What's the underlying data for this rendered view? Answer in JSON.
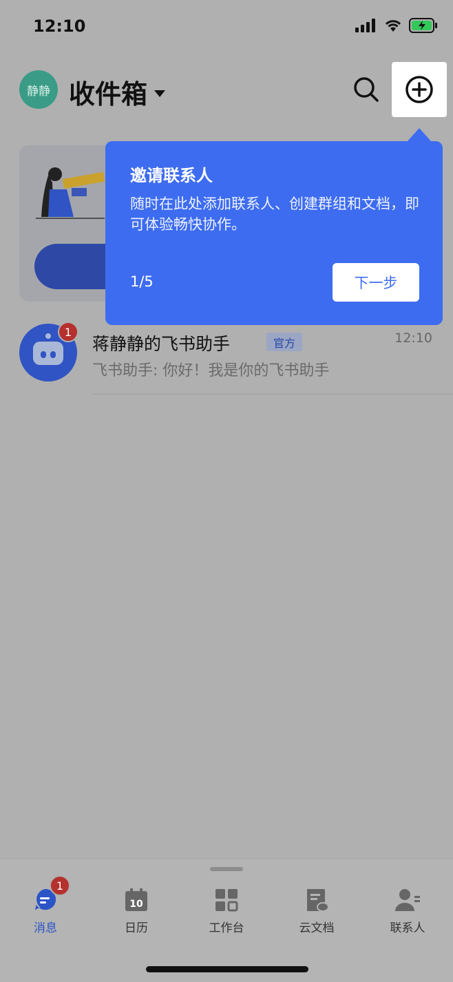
{
  "status_bar": {
    "time": "12:10"
  },
  "header": {
    "avatar_text": "静静",
    "title": "收件箱",
    "search_icon": "search-icon",
    "add_icon": "plus-circle-icon"
  },
  "tooltip": {
    "title": "邀请联系人",
    "body": "随时在此处添加联系人、创建群组和文档，即可体验畅快协作。",
    "step": "1/5",
    "next_label": "下一步",
    "bg_color": "#3d6cf0"
  },
  "chats": [
    {
      "name": "蒋静静的飞书助手",
      "tag": "官方",
      "time": "12:10",
      "preview": "飞书助手: 你好！我是你的飞书助手",
      "unread": "1"
    }
  ],
  "tabbar": {
    "tabs": [
      {
        "label": "消息",
        "icon": "message-icon",
        "badge": "1",
        "active": true
      },
      {
        "label": "日历",
        "icon": "calendar-icon",
        "icon_text": "10"
      },
      {
        "label": "工作台",
        "icon": "workplace-icon"
      },
      {
        "label": "云文档",
        "icon": "cloud-doc-icon"
      },
      {
        "label": "联系人",
        "icon": "contacts-icon"
      }
    ]
  },
  "colors": {
    "accent": "#3d6cf0",
    "badge": "#b5312e",
    "overlay": "#b0b0b0"
  }
}
